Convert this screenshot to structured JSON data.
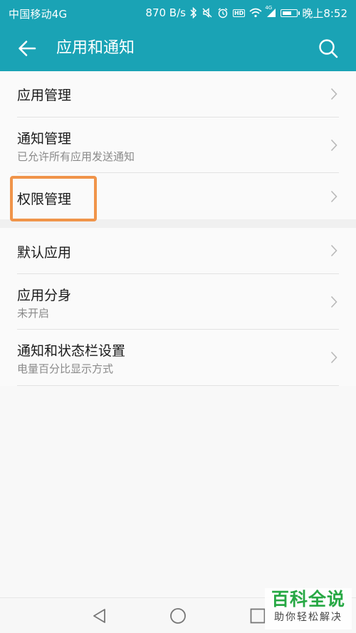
{
  "status_bar": {
    "carrier": "中国移动4G",
    "speed": "870 B/s",
    "time": "晚上8:52",
    "hd_badge": "HD",
    "signal_label": "4G",
    "battery_level": 0.7,
    "icons": [
      "bluetooth-icon",
      "mute-icon",
      "alarm-icon",
      "hd-icon",
      "wifi-icon",
      "signal-icon",
      "battery-icon"
    ]
  },
  "app_bar": {
    "title": "应用和通知",
    "back_icon": "back-arrow-icon",
    "search_icon": "search-icon"
  },
  "groups": [
    {
      "items": [
        {
          "label": "应用管理",
          "sub": ""
        },
        {
          "label": "通知管理",
          "sub": "已允许所有应用发送通知"
        },
        {
          "label": "权限管理",
          "sub": ""
        }
      ]
    },
    {
      "items": [
        {
          "label": "默认应用",
          "sub": ""
        },
        {
          "label": "应用分身",
          "sub": "未开启"
        },
        {
          "label": "通知和状态栏设置",
          "sub": "电量百分比显示方式"
        }
      ]
    }
  ],
  "nav_bar": {
    "icons": [
      "back-triangle-icon",
      "home-circle-icon",
      "recents-square-icon"
    ]
  },
  "watermark": {
    "main": "百科全说",
    "sub": "助你轻松解决"
  },
  "colors": {
    "accent": "#1aa3b5",
    "highlight": "#f0944a",
    "watermark_green": "#27a844"
  }
}
